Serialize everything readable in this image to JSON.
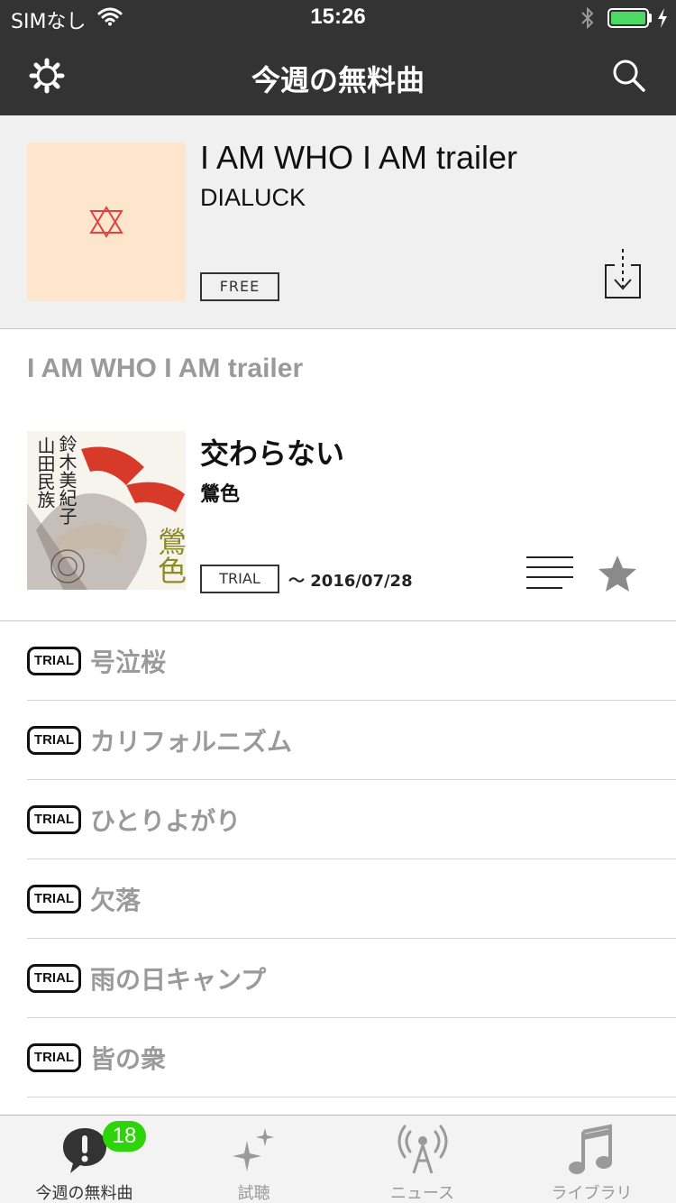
{
  "status_bar": {
    "carrier": "SIMなし",
    "time": "15:26",
    "battery_color": "#4cd964"
  },
  "nav": {
    "title": "今週の無料曲",
    "left_icon": "gear-icon",
    "right_icon": "search-icon"
  },
  "featured": {
    "title": "I AM WHO I AM trailer",
    "artist": "DIALUCK",
    "badge": "FREE",
    "art_color": "#fde6cb",
    "action_icon": "download-icon"
  },
  "album": {
    "heading": "I AM WHO I AM trailer",
    "title": "交わらない",
    "artist": "鶯色",
    "badge": "TRIAL",
    "date": "～ 2016/07/28",
    "art_text_vertical": "鈴木美紀子",
    "art_text_vertical2": "山田民族",
    "art_text_title": "鶯色"
  },
  "tracks": [
    {
      "badge": "TRIAL",
      "name": "号泣桜"
    },
    {
      "badge": "TRIAL",
      "name": "カリフォルニズム"
    },
    {
      "badge": "TRIAL",
      "name": "ひとりよがり"
    },
    {
      "badge": "TRIAL",
      "name": "欠落"
    },
    {
      "badge": "TRIAL",
      "name": "雨の日キャンプ"
    },
    {
      "badge": "TRIAL",
      "name": "皆の衆"
    }
  ],
  "tabbar": {
    "items": [
      {
        "label": "今週の無料曲",
        "icon": "exclamation-bubble-icon",
        "badge": "18",
        "active": true
      },
      {
        "label": "試聴",
        "icon": "sparkle-icon",
        "active": false
      },
      {
        "label": "ニュース",
        "icon": "broadcast-icon",
        "active": false
      },
      {
        "label": "ライブラリ",
        "icon": "music-note-icon",
        "active": false
      }
    ],
    "badge_color": "#2dd40a"
  }
}
